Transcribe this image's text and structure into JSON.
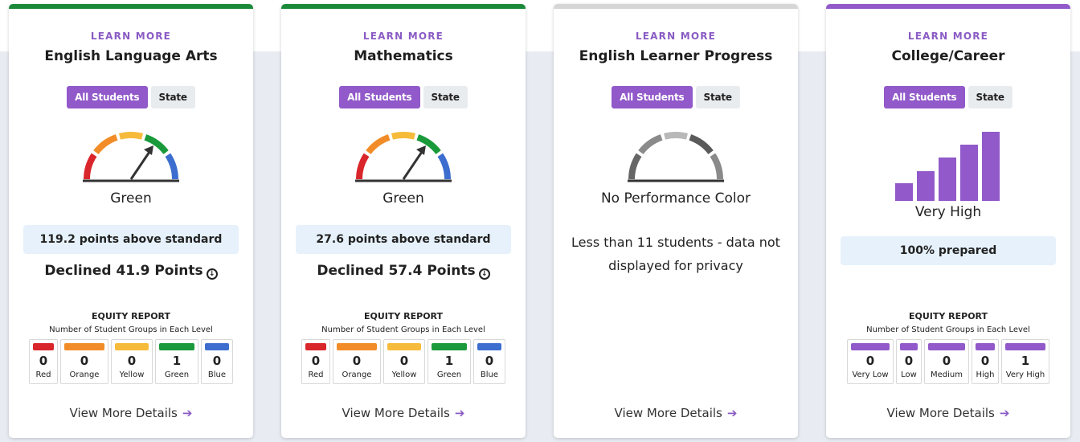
{
  "colors": {
    "purple": "#9159c9",
    "green": "#1a8a3a",
    "gray": "#d6d6d6",
    "red": "#d9262b",
    "orange": "#f28c28",
    "yellow": "#f6bb3a",
    "gaugeGreen": "#1a9a3a",
    "blue": "#3d6ecf"
  },
  "cards": [
    {
      "learn_more": "LEARN MORE",
      "title": "English Language Arts",
      "toggle_all": "All Students",
      "toggle_state": "State",
      "performance": "Green",
      "gauge_level": 4,
      "stat": "119.2 points above standard",
      "change": "Declined 41.9 Points",
      "equity_title": "EQUITY REPORT",
      "equity_sub": "Number of Student Groups in Each Level",
      "levels": [
        {
          "label": "Red",
          "value": "0"
        },
        {
          "label": "Orange",
          "value": "0"
        },
        {
          "label": "Yellow",
          "value": "0"
        },
        {
          "label": "Green",
          "value": "1"
        },
        {
          "label": "Blue",
          "value": "0"
        }
      ],
      "details": "View More Details"
    },
    {
      "learn_more": "LEARN MORE",
      "title": "Mathematics",
      "toggle_all": "All Students",
      "toggle_state": "State",
      "performance": "Green",
      "gauge_level": 4,
      "stat": "27.6 points above standard",
      "change": "Declined 57.4 Points",
      "equity_title": "EQUITY REPORT",
      "equity_sub": "Number of Student Groups in Each Level",
      "levels": [
        {
          "label": "Red",
          "value": "0"
        },
        {
          "label": "Orange",
          "value": "0"
        },
        {
          "label": "Yellow",
          "value": "0"
        },
        {
          "label": "Green",
          "value": "1"
        },
        {
          "label": "Blue",
          "value": "0"
        }
      ],
      "details": "View More Details"
    },
    {
      "learn_more": "LEARN MORE",
      "title": "English Learner Progress",
      "toggle_all": "All Students",
      "toggle_state": "State",
      "performance": "No Performance Color",
      "privacy": "Less than 11 students - data not displayed for privacy",
      "details": "View More Details"
    },
    {
      "learn_more": "LEARN MORE",
      "title": "College/Career",
      "toggle_all": "All Students",
      "toggle_state": "State",
      "performance": "Very High",
      "stat": "100% prepared",
      "equity_title": "EQUITY REPORT",
      "equity_sub": "Number of Student Groups in Each Level",
      "levels": [
        {
          "label": "Very Low",
          "value": "0"
        },
        {
          "label": "Low",
          "value": "0"
        },
        {
          "label": "Medium",
          "value": "0"
        },
        {
          "label": "High",
          "value": "0"
        },
        {
          "label": "Very High",
          "value": "1"
        }
      ],
      "details": "View More Details"
    }
  ]
}
